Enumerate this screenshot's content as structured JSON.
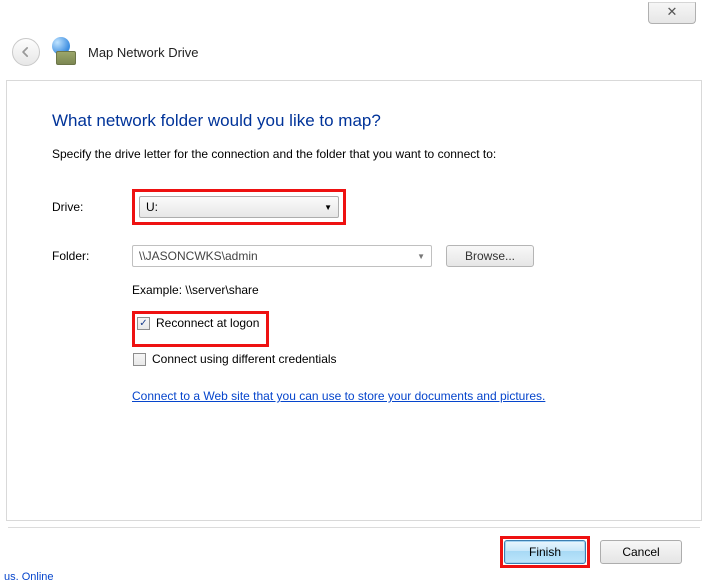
{
  "window": {
    "close_glyph": "✕"
  },
  "header": {
    "title": "Map Network Drive"
  },
  "main": {
    "heading": "What network folder would you like to map?",
    "description": "Specify the drive letter for the connection and the folder that you want to connect to:",
    "drive_label": "Drive:",
    "drive_value": "U:",
    "folder_label": "Folder:",
    "folder_value": "\\\\JASONCWKS\\admin",
    "browse_label": "Browse...",
    "example_text": "Example: \\\\server\\share",
    "reconnect_label": "Reconnect at logon",
    "diffcreds_label": "Connect using different credentials",
    "link_text": "Connect to a Web site that you can use to store your documents and pictures"
  },
  "footer": {
    "finish_label": "Finish",
    "cancel_label": "Cancel"
  },
  "status": {
    "text": "us. Online"
  }
}
